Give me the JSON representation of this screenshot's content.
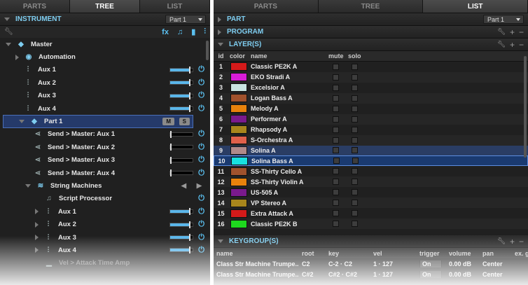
{
  "left": {
    "tabs": [
      "PARTS",
      "TREE",
      "LIST"
    ],
    "header": {
      "title": "INSTRUMENT",
      "select": "Part 1"
    },
    "toolbar": {
      "fx": "fx"
    },
    "tree": [
      {
        "label": "Master",
        "icon": "cube-icon"
      },
      {
        "label": "Automation",
        "icon": "automation-icon"
      },
      {
        "label": "Aux 1",
        "icon": "sliders-icon"
      },
      {
        "label": "Aux 2",
        "icon": "sliders-icon"
      },
      {
        "label": "Aux 3",
        "icon": "sliders-icon"
      },
      {
        "label": "Aux 4",
        "icon": "sliders-icon"
      },
      {
        "label": "Part 1",
        "icon": "diamond-icon",
        "btn_m": "M",
        "btn_s": "S"
      },
      {
        "label": "Send > Master: Aux 1",
        "icon": "send-icon"
      },
      {
        "label": "Send > Master: Aux 2",
        "icon": "send-icon"
      },
      {
        "label": "Send > Master: Aux 3",
        "icon": "send-icon"
      },
      {
        "label": "Send > Master: Aux 4",
        "icon": "send-icon"
      },
      {
        "label": "String Machines",
        "icon": "layers-icon"
      },
      {
        "label": "Script Processor",
        "icon": "note-icon"
      },
      {
        "label": "Aux 1",
        "icon": "sliders-icon"
      },
      {
        "label": "Aux 2",
        "icon": "sliders-icon"
      },
      {
        "label": "Aux 3",
        "icon": "sliders-icon"
      },
      {
        "label": "Aux 4",
        "icon": "sliders-icon"
      },
      {
        "label": "Vel > Attack Time Amp",
        "icon": "mod-icon"
      }
    ]
  },
  "right": {
    "tabs": [
      "PARTS",
      "TREE",
      "LIST"
    ],
    "part": {
      "title": "PART",
      "select": "Part 1"
    },
    "program": {
      "title": "PROGRAM"
    },
    "layers": {
      "title": "LAYER(S)"
    },
    "columns": [
      "id",
      "color",
      "name",
      "mute",
      "solo"
    ],
    "rows": [
      {
        "id": "1",
        "name": "Classic PE2K A",
        "color": "#d41a1a"
      },
      {
        "id": "2",
        "name": "EKO Stradi A",
        "color": "#d81cd8"
      },
      {
        "id": "3",
        "name": "Excelsior A",
        "color": "#c9e4e2"
      },
      {
        "id": "4",
        "name": "Logan Bass A",
        "color": "#a0522d"
      },
      {
        "id": "5",
        "name": "Melody A",
        "color": "#e8820c"
      },
      {
        "id": "6",
        "name": "Performer A",
        "color": "#7a1a8c"
      },
      {
        "id": "7",
        "name": "Rhapsody A",
        "color": "#a8861c"
      },
      {
        "id": "8",
        "name": "S-Orchestra A",
        "color": "#e0604a"
      },
      {
        "id": "9",
        "name": "Solina A",
        "color": "#b08a8a"
      },
      {
        "id": "10",
        "name": "Solina Bass A",
        "color": "#18e0e0"
      },
      {
        "id": "11",
        "name": "SS-Thirty Cello A",
        "color": "#a0522d"
      },
      {
        "id": "12",
        "name": "SS-Thirty Violin A",
        "color": "#e8820c"
      },
      {
        "id": "13",
        "name": "US-505 A",
        "color": "#7a1a8c"
      },
      {
        "id": "14",
        "name": "VP Stereo A",
        "color": "#a8861c"
      },
      {
        "id": "15",
        "name": "Extra Attack A",
        "color": "#d41a1a"
      },
      {
        "id": "16",
        "name": "Classic PE2K B",
        "color": "#1ed81e"
      }
    ],
    "keygroups": {
      "title": "KEYGROUP(S)"
    },
    "kcols": [
      "name",
      "root",
      "key",
      "vel",
      "trigger",
      "volume",
      "pan",
      "ex. g"
    ],
    "krows": [
      {
        "name": "Class Str Machine Trumpe...",
        "root": "C2",
        "key": "C-2  ·  C2",
        "vel": "1  ·  127",
        "trigger": "On",
        "volume": "0.00 dB",
        "pan": "Center"
      },
      {
        "name": "Class Str Machine Trumpe...",
        "root": "C#2",
        "key": "C#2  ·  C#2",
        "vel": "1  ·  127",
        "trigger": "On",
        "volume": "0.00 dB",
        "pan": "Center"
      }
    ]
  }
}
